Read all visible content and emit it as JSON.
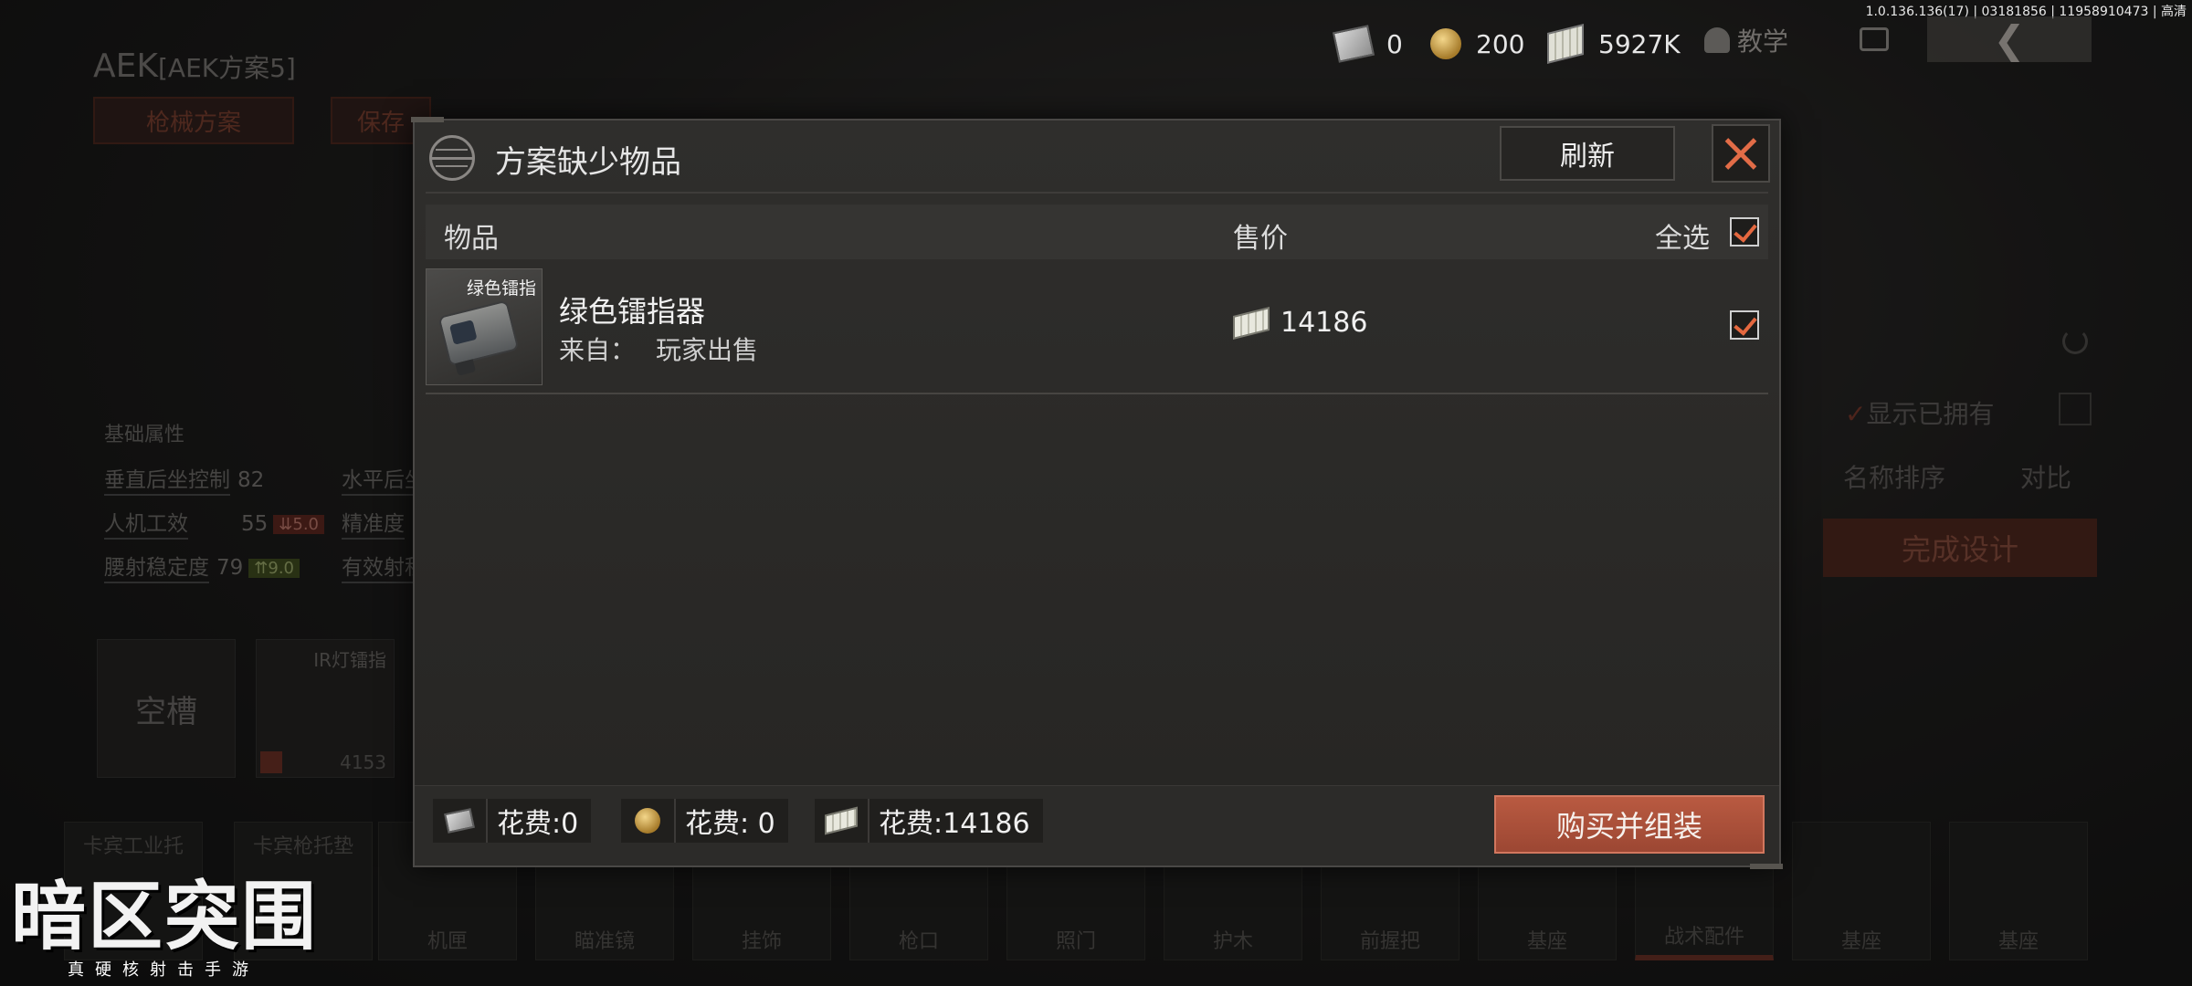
{
  "version": "1.0.136.136(17) | 03181856 | 11958910473 | 高清",
  "resources": {
    "ticket": "0",
    "coin": "200",
    "cash": "5927K"
  },
  "nav": {
    "tutorial_label": "教学",
    "back_icon": "chevron-left-icon"
  },
  "background": {
    "weapon_name": "AEK",
    "weapon_plan": "[AEK方案5]",
    "tabs": [
      "枪械方案",
      "保存"
    ],
    "section_title": "基础属性",
    "stats": [
      {
        "name": "垂直后坐控制",
        "value": "82"
      },
      {
        "name": "人机工效",
        "value": "55",
        "delta": "5.0",
        "delta_dir": "down"
      },
      {
        "name": "腰射稳定度",
        "value": "79",
        "delta": "9.0",
        "delta_dir": "up"
      }
    ],
    "stats_right": [
      "水平后坐",
      "精准度",
      "有效射程"
    ],
    "slot_empty_label": "空槽",
    "slot_ir_label": "IR灯镭指",
    "slot_ir_count": "4153",
    "right_panel": {
      "show_owned": "显示已拥有",
      "sort_name": "名称排序",
      "compare": "对比",
      "complete_design": "完成设计"
    },
    "categories": [
      {
        "top": "卡宾工业托",
        "bottom": ""
      },
      {
        "top": "卡宾枪托垫",
        "bottom": ""
      },
      {
        "top": "",
        "bottom": "机匣"
      },
      {
        "top": "",
        "bottom": "瞄准镜"
      },
      {
        "top": "",
        "bottom": "挂饰"
      },
      {
        "top": "",
        "bottom": "枪口"
      },
      {
        "top": "",
        "bottom": "照门"
      },
      {
        "top": "",
        "bottom": "护木"
      },
      {
        "top": "",
        "bottom": "前握把"
      },
      {
        "top": "",
        "bottom": "基座"
      },
      {
        "top": "",
        "bottom": "战术配件"
      },
      {
        "top": "",
        "bottom": "基座"
      },
      {
        "top": "",
        "bottom": "基座"
      }
    ]
  },
  "dialog": {
    "title": "方案缺少物品",
    "refresh_label": "刷新",
    "columns": {
      "item": "物品",
      "price": "售价",
      "select_all": "全选"
    },
    "select_all_checked": true,
    "items": [
      {
        "thumb_tag": "绿色镭指",
        "name": "绿色镭指器",
        "source_label": "来自：",
        "source_value": "玩家出售",
        "price": "14186",
        "checked": true
      }
    ],
    "costs": [
      {
        "icon": "ticket-icon",
        "label": "花费:0"
      },
      {
        "icon": "coin-icon",
        "label": "花费: 0"
      },
      {
        "icon": "cash-icon",
        "label": "花费:14186"
      }
    ],
    "buy_label": "购买并组装"
  },
  "branding": {
    "logo_text": "暗区突围",
    "tagline": "真硬核射击手游"
  },
  "colors": {
    "accent": "#e5683f",
    "buy_button": "#b95a41"
  }
}
